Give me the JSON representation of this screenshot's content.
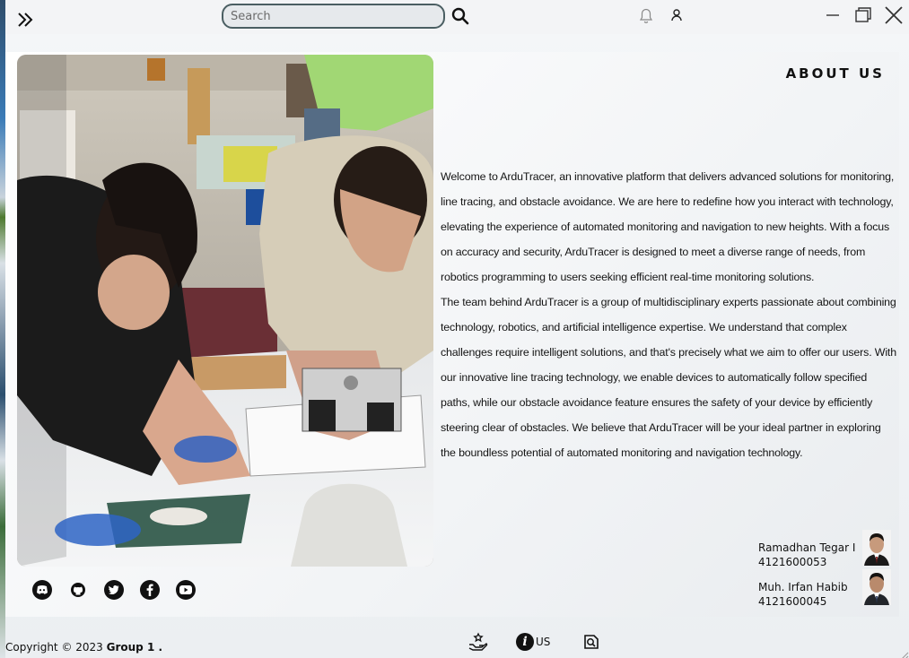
{
  "topbar": {
    "search_placeholder": "Search",
    "icons": [
      "double-chevron-right-icon",
      "search-icon",
      "bell-icon",
      "user-icon",
      "minimize-icon",
      "maximize-icon",
      "close-icon"
    ]
  },
  "about": {
    "title": "ABOUT US",
    "paragraph_1": "Welcome to ArduTracer, an innovative platform that delivers advanced solutions for monitoring, line tracing, and obstacle avoidance. We are here to redefine how you interact with technology, elevating the experience of automated monitoring and navigation to new heights. With a focus on accuracy and security, ArduTracer is designed to meet a diverse range of needs, from robotics programming to users seeking efficient real-time monitoring solutions.",
    "paragraph_2": "The team behind ArduTracer is a group of multidisciplinary experts passionate about combining technology, robotics, and artificial intelligence expertise. We understand that complex challenges require intelligent solutions, and that's precisely what we aim to offer our users. With our innovative line tracing technology, we enable devices to automatically follow specified paths, while our obstacle avoidance feature ensures the safety of your device by efficiently steering clear of obstacles. We believe that ArduTracer will be your ideal partner in exploring the boundless potential of automated monitoring and navigation technology."
  },
  "social": [
    "discord-icon",
    "github-icon",
    "twitter-icon",
    "facebook-icon",
    "youtube-icon"
  ],
  "members": [
    {
      "name": "Ramadhan Tegar I",
      "id": "4121600053"
    },
    {
      "name": "Muh. Irfan Habib",
      "id": "4121600045"
    }
  ],
  "footer": {
    "copyright_prefix": "Copyright © 2023 ",
    "copyright_group": "Group 1 .",
    "info_label": "US"
  },
  "colors": {
    "search_border": "#4a5e62",
    "icon_dark": "#111111",
    "panel_bg": "#f2f4f6"
  }
}
